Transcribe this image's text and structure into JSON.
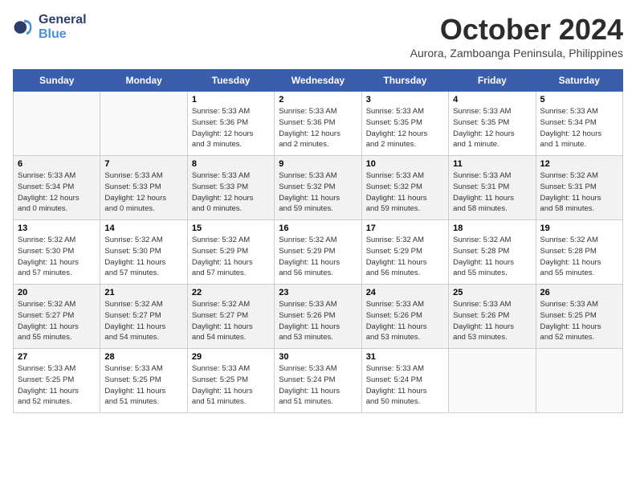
{
  "header": {
    "logo_line1": "General",
    "logo_line2": "Blue",
    "month": "October 2024",
    "location": "Aurora, Zamboanga Peninsula, Philippines"
  },
  "weekdays": [
    "Sunday",
    "Monday",
    "Tuesday",
    "Wednesday",
    "Thursday",
    "Friday",
    "Saturday"
  ],
  "weeks": [
    [
      {
        "day": "",
        "info": ""
      },
      {
        "day": "",
        "info": ""
      },
      {
        "day": "1",
        "info": "Sunrise: 5:33 AM\nSunset: 5:36 PM\nDaylight: 12 hours\nand 3 minutes."
      },
      {
        "day": "2",
        "info": "Sunrise: 5:33 AM\nSunset: 5:36 PM\nDaylight: 12 hours\nand 2 minutes."
      },
      {
        "day": "3",
        "info": "Sunrise: 5:33 AM\nSunset: 5:35 PM\nDaylight: 12 hours\nand 2 minutes."
      },
      {
        "day": "4",
        "info": "Sunrise: 5:33 AM\nSunset: 5:35 PM\nDaylight: 12 hours\nand 1 minute."
      },
      {
        "day": "5",
        "info": "Sunrise: 5:33 AM\nSunset: 5:34 PM\nDaylight: 12 hours\nand 1 minute."
      }
    ],
    [
      {
        "day": "6",
        "info": "Sunrise: 5:33 AM\nSunset: 5:34 PM\nDaylight: 12 hours\nand 0 minutes."
      },
      {
        "day": "7",
        "info": "Sunrise: 5:33 AM\nSunset: 5:33 PM\nDaylight: 12 hours\nand 0 minutes."
      },
      {
        "day": "8",
        "info": "Sunrise: 5:33 AM\nSunset: 5:33 PM\nDaylight: 12 hours\nand 0 minutes."
      },
      {
        "day": "9",
        "info": "Sunrise: 5:33 AM\nSunset: 5:32 PM\nDaylight: 11 hours\nand 59 minutes."
      },
      {
        "day": "10",
        "info": "Sunrise: 5:33 AM\nSunset: 5:32 PM\nDaylight: 11 hours\nand 59 minutes."
      },
      {
        "day": "11",
        "info": "Sunrise: 5:33 AM\nSunset: 5:31 PM\nDaylight: 11 hours\nand 58 minutes."
      },
      {
        "day": "12",
        "info": "Sunrise: 5:32 AM\nSunset: 5:31 PM\nDaylight: 11 hours\nand 58 minutes."
      }
    ],
    [
      {
        "day": "13",
        "info": "Sunrise: 5:32 AM\nSunset: 5:30 PM\nDaylight: 11 hours\nand 57 minutes."
      },
      {
        "day": "14",
        "info": "Sunrise: 5:32 AM\nSunset: 5:30 PM\nDaylight: 11 hours\nand 57 minutes."
      },
      {
        "day": "15",
        "info": "Sunrise: 5:32 AM\nSunset: 5:29 PM\nDaylight: 11 hours\nand 57 minutes."
      },
      {
        "day": "16",
        "info": "Sunrise: 5:32 AM\nSunset: 5:29 PM\nDaylight: 11 hours\nand 56 minutes."
      },
      {
        "day": "17",
        "info": "Sunrise: 5:32 AM\nSunset: 5:29 PM\nDaylight: 11 hours\nand 56 minutes."
      },
      {
        "day": "18",
        "info": "Sunrise: 5:32 AM\nSunset: 5:28 PM\nDaylight: 11 hours\nand 55 minutes."
      },
      {
        "day": "19",
        "info": "Sunrise: 5:32 AM\nSunset: 5:28 PM\nDaylight: 11 hours\nand 55 minutes."
      }
    ],
    [
      {
        "day": "20",
        "info": "Sunrise: 5:32 AM\nSunset: 5:27 PM\nDaylight: 11 hours\nand 55 minutes."
      },
      {
        "day": "21",
        "info": "Sunrise: 5:32 AM\nSunset: 5:27 PM\nDaylight: 11 hours\nand 54 minutes."
      },
      {
        "day": "22",
        "info": "Sunrise: 5:32 AM\nSunset: 5:27 PM\nDaylight: 11 hours\nand 54 minutes."
      },
      {
        "day": "23",
        "info": "Sunrise: 5:33 AM\nSunset: 5:26 PM\nDaylight: 11 hours\nand 53 minutes."
      },
      {
        "day": "24",
        "info": "Sunrise: 5:33 AM\nSunset: 5:26 PM\nDaylight: 11 hours\nand 53 minutes."
      },
      {
        "day": "25",
        "info": "Sunrise: 5:33 AM\nSunset: 5:26 PM\nDaylight: 11 hours\nand 53 minutes."
      },
      {
        "day": "26",
        "info": "Sunrise: 5:33 AM\nSunset: 5:25 PM\nDaylight: 11 hours\nand 52 minutes."
      }
    ],
    [
      {
        "day": "27",
        "info": "Sunrise: 5:33 AM\nSunset: 5:25 PM\nDaylight: 11 hours\nand 52 minutes."
      },
      {
        "day": "28",
        "info": "Sunrise: 5:33 AM\nSunset: 5:25 PM\nDaylight: 11 hours\nand 51 minutes."
      },
      {
        "day": "29",
        "info": "Sunrise: 5:33 AM\nSunset: 5:25 PM\nDaylight: 11 hours\nand 51 minutes."
      },
      {
        "day": "30",
        "info": "Sunrise: 5:33 AM\nSunset: 5:24 PM\nDaylight: 11 hours\nand 51 minutes."
      },
      {
        "day": "31",
        "info": "Sunrise: 5:33 AM\nSunset: 5:24 PM\nDaylight: 11 hours\nand 50 minutes."
      },
      {
        "day": "",
        "info": ""
      },
      {
        "day": "",
        "info": ""
      }
    ]
  ]
}
